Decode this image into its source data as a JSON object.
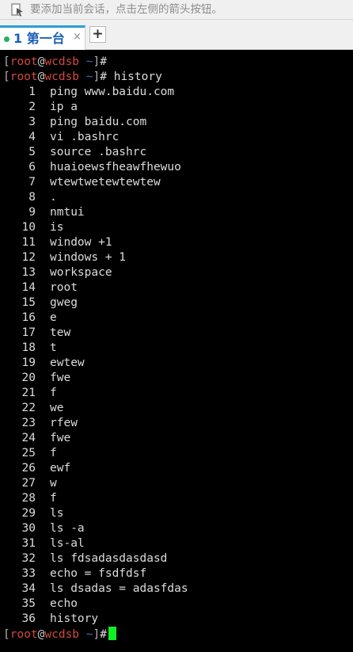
{
  "hint_bar": {
    "icon": "session-arrow-icon",
    "text": "要添加当前会话，点击左侧的箭头按钮。"
  },
  "tabs": {
    "active": {
      "label": "1 第一台",
      "status_color": "#21b25f",
      "close": "×"
    },
    "add_label": "+"
  },
  "terminal": {
    "prompt": {
      "user": "root",
      "at": "@",
      "host": "wcdsb",
      "dir": "~",
      "symbol": "#"
    },
    "commands": [
      {
        "command": ""
      },
      {
        "command": "history"
      }
    ],
    "history": [
      {
        "num": "1",
        "cmd": "ping www.baidu.com"
      },
      {
        "num": "2",
        "cmd": "ip a"
      },
      {
        "num": "3",
        "cmd": "ping baidu.com"
      },
      {
        "num": "4",
        "cmd": "vi .bashrc"
      },
      {
        "num": "5",
        "cmd": "source .bashrc"
      },
      {
        "num": "6",
        "cmd": "huaioewsfheawfhewuo"
      },
      {
        "num": "7",
        "cmd": "wtewtwetewtewtew"
      },
      {
        "num": "8",
        "cmd": "."
      },
      {
        "num": "9",
        "cmd": "nmtui"
      },
      {
        "num": "10",
        "cmd": "is"
      },
      {
        "num": "11",
        "cmd": "window +1"
      },
      {
        "num": "12",
        "cmd": "windows + 1"
      },
      {
        "num": "13",
        "cmd": "workspace"
      },
      {
        "num": "14",
        "cmd": "root"
      },
      {
        "num": "15",
        "cmd": "gweg"
      },
      {
        "num": "16",
        "cmd": "e"
      },
      {
        "num": "17",
        "cmd": "tew"
      },
      {
        "num": "18",
        "cmd": "t"
      },
      {
        "num": "19",
        "cmd": "ewtew"
      },
      {
        "num": "20",
        "cmd": "fwe"
      },
      {
        "num": "21",
        "cmd": "f"
      },
      {
        "num": "22",
        "cmd": "we"
      },
      {
        "num": "23",
        "cmd": "rfew"
      },
      {
        "num": "24",
        "cmd": "fwe"
      },
      {
        "num": "25",
        "cmd": "f"
      },
      {
        "num": "26",
        "cmd": "ewf"
      },
      {
        "num": "27",
        "cmd": "w"
      },
      {
        "num": "28",
        "cmd": "f"
      },
      {
        "num": "29",
        "cmd": "ls"
      },
      {
        "num": "30",
        "cmd": "ls -a"
      },
      {
        "num": "31",
        "cmd": "ls-al"
      },
      {
        "num": "32",
        "cmd": "ls fdsadasdasdasd"
      },
      {
        "num": "33",
        "cmd": "echo = fsdfdsf"
      },
      {
        "num": "34",
        "cmd": "ls dsadas = adasfdas"
      },
      {
        "num": "35",
        "cmd": "echo"
      },
      {
        "num": "36",
        "cmd": "history"
      }
    ],
    "cursor_color": "#10f020"
  }
}
